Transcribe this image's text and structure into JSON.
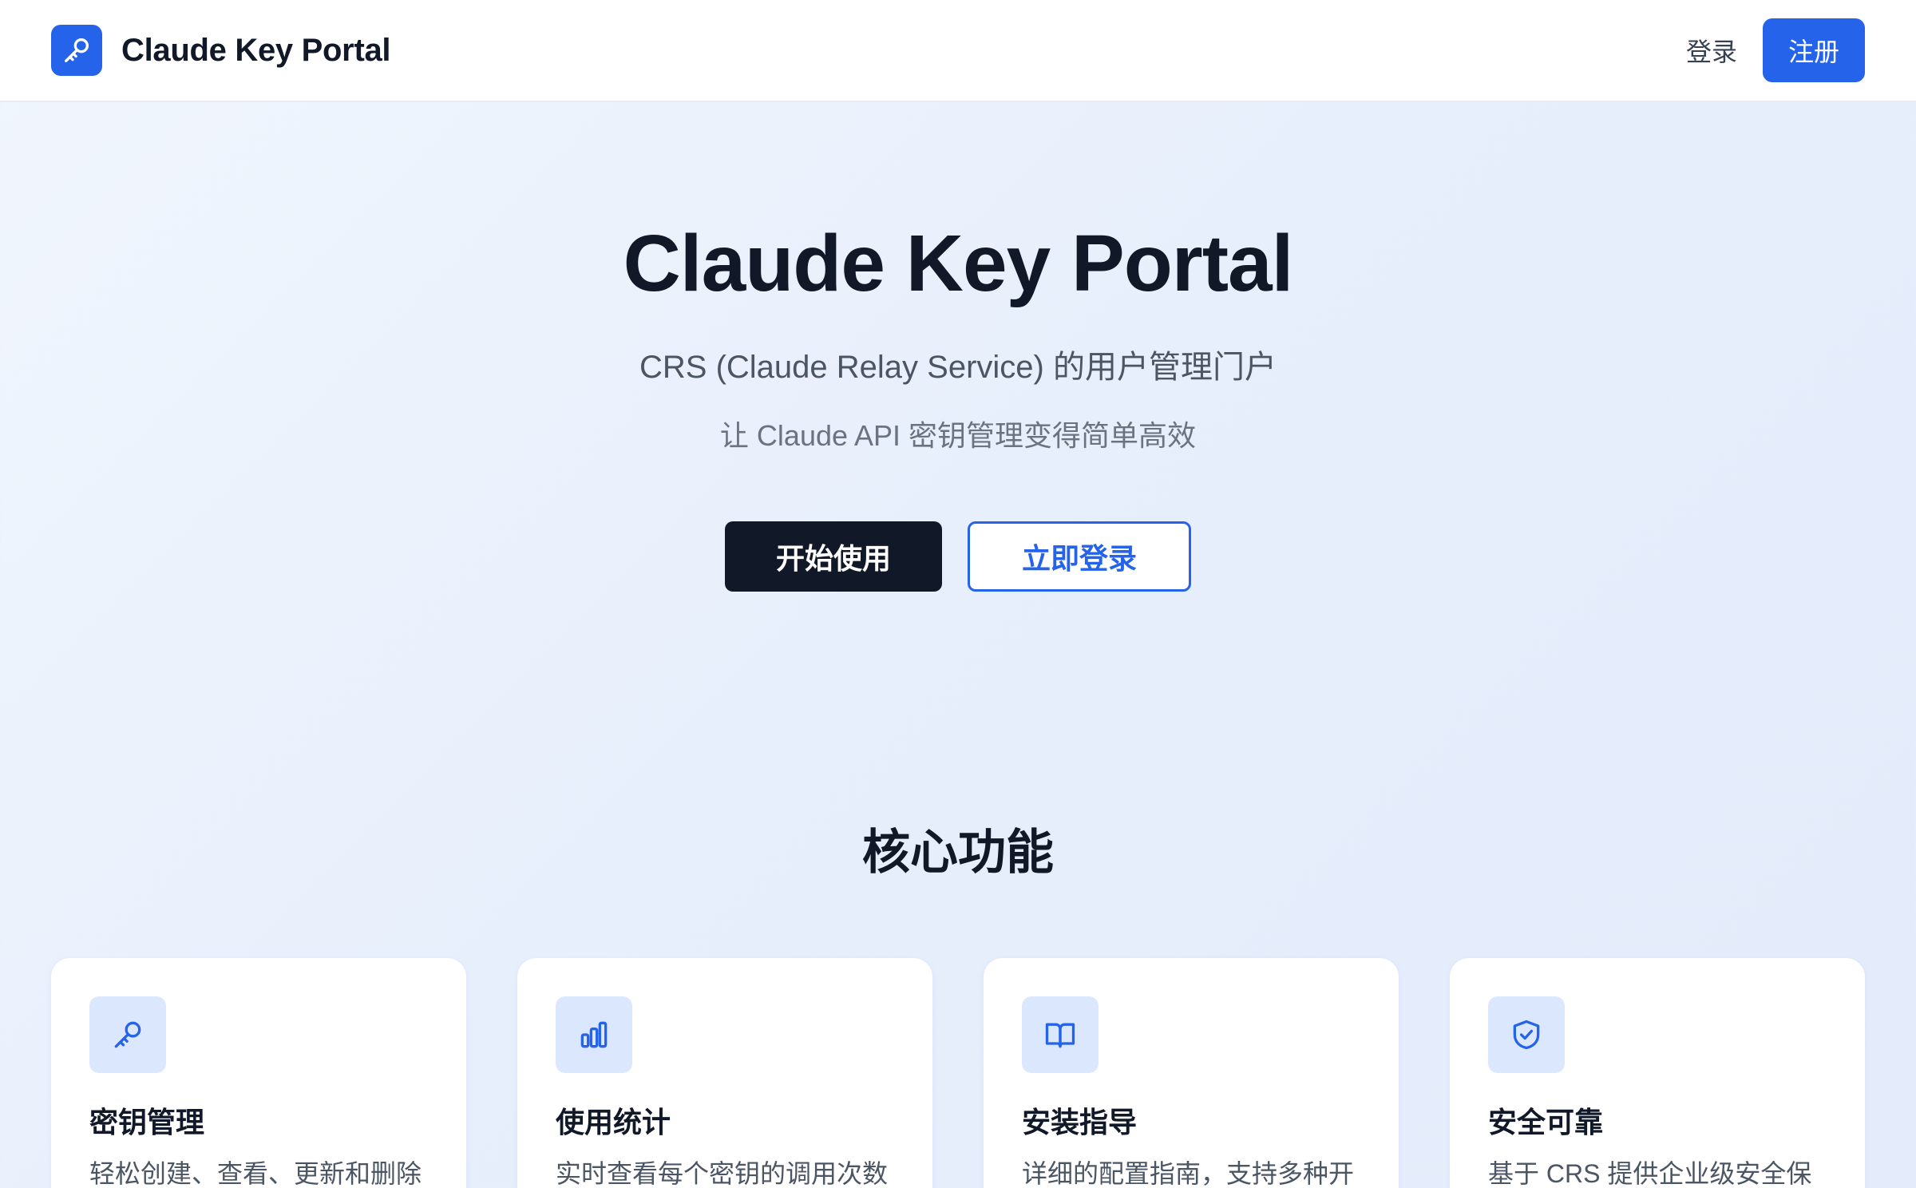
{
  "navbar": {
    "brand_icon": "key-icon",
    "brand_name": "Claude Key Portal",
    "login_label": "登录",
    "register_label": "注册"
  },
  "hero": {
    "title": "Claude Key Portal",
    "subtitle": "CRS (Claude Relay Service) 的用户管理门户",
    "tagline": "让 Claude API 密钥管理变得简单高效",
    "primary_button": "开始使用",
    "secondary_button": "立即登录"
  },
  "features": {
    "heading": "核心功能",
    "items": [
      {
        "icon": "key-icon",
        "title": "密钥管理",
        "description": "轻松创建、查看、更新和删除"
      },
      {
        "icon": "bar-chart-icon",
        "title": "使用统计",
        "description": "实时查看每个密钥的调用次数"
      },
      {
        "icon": "book-icon",
        "title": "安装指导",
        "description": "详细的配置指南，支持多种开"
      },
      {
        "icon": "shield-check-icon",
        "title": "安全可靠",
        "description": "基于 CRS 提供企业级安全保"
      }
    ]
  },
  "colors": {
    "accent": "#2563eb",
    "dark_button": "#111827",
    "icon_tile": "#dbe7fd"
  }
}
